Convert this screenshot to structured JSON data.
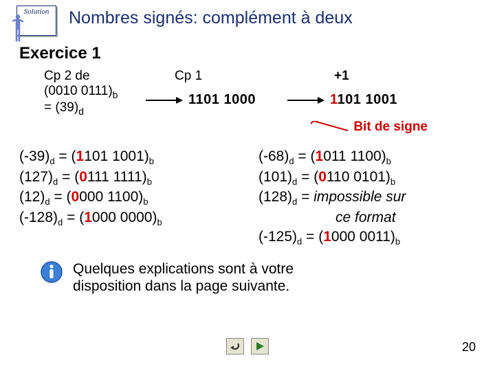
{
  "badge_label": "Solution",
  "title": "Nombres signés: complément à deux",
  "subtitle": "Exercice 1",
  "diagram": {
    "cp2_label": "Cp 2 de",
    "cp1_label": "Cp 1",
    "plus1_label": "+1",
    "line2_left_a": "(0010 0111)",
    "line2_left_a_sub": "b",
    "line2_left_b": "= (39)",
    "line2_left_b_sub": "d",
    "bin1": "1101 1000",
    "bin2_redbit": "1",
    "bin2_rest": "101 1001"
  },
  "annot": "Bit de signe",
  "left_col": [
    {
      "lhs": "(-39)",
      "lsub": "d",
      "eq": " = (",
      "redbit": "1",
      "rest": "101 1001)",
      "rsub": "b"
    },
    {
      "lhs": "(127)",
      "lsub": "d",
      "eq": " = (",
      "redbit": "0",
      "rest": "111 1111)",
      "rsub": "b"
    },
    {
      "lhs": "(12)",
      "lsub": "d",
      "eq": " = (",
      "redbit": "0",
      "rest": "000 1100)",
      "rsub": "b"
    },
    {
      "lhs": "(-128)",
      "lsub": "d",
      "eq": " = (",
      "redbit": "1",
      "rest": "000 0000)",
      "rsub": "b"
    }
  ],
  "right_col": [
    {
      "lhs": "(-68)",
      "lsub": "d",
      "eq": " = (",
      "redbit": "1",
      "rest": "011 1100)",
      "rsub": "b"
    },
    {
      "lhs": "(101)",
      "lsub": "d",
      "eq": " = (",
      "redbit": "0",
      "rest": "110 0101)",
      "rsub": "b"
    }
  ],
  "impossible": {
    "lhs": "(128)",
    "lsub": "d",
    "eq": " = ",
    "text1": "impossible sur",
    "text2": "ce format"
  },
  "right_last": {
    "lhs": "(-125)",
    "lsub": "d",
    "eq": " = (",
    "redbit": "1",
    "rest": "000 0011)",
    "rsub": "b"
  },
  "foot_text1": "Quelques explications sont à votre",
  "foot_text2": "disposition dans la page suivante.",
  "pagenum": "20"
}
